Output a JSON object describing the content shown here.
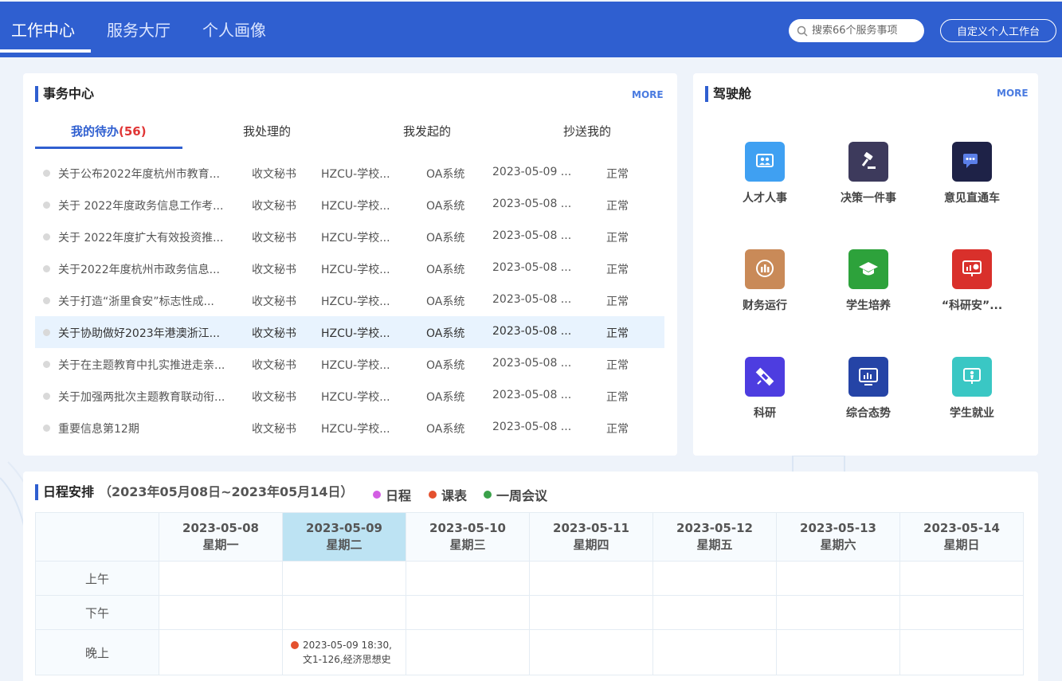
{
  "header": {
    "tabs": [
      "工作中心",
      "服务大厅",
      "个人画像"
    ],
    "search_placeholder": "搜索66个服务事项",
    "custom_button": "自定义个人工作台"
  },
  "affairs": {
    "title": "事务中心",
    "more": "MORE",
    "tabs": [
      {
        "label": "我的待办",
        "count": "(56)"
      },
      {
        "label": "我处理的"
      },
      {
        "label": "我发起的"
      },
      {
        "label": "抄送我的"
      }
    ],
    "rows": [
      {
        "title": "关于公布2022年度杭州市教育...",
        "type": "收文秘书",
        "dept": "HZCU-学校...",
        "system": "OA系统",
        "date": "2023-05-09 ...",
        "status": "正常"
      },
      {
        "title": "关于 2022年度政务信息工作考...",
        "type": "收文秘书",
        "dept": "HZCU-学校...",
        "system": "OA系统",
        "date": "2023-05-08 ...",
        "status": "正常"
      },
      {
        "title": "关于 2022年度扩大有效投资推...",
        "type": "收文秘书",
        "dept": "HZCU-学校...",
        "system": "OA系统",
        "date": "2023-05-08 ...",
        "status": "正常"
      },
      {
        "title": "关于2022年度杭州市政务信息...",
        "type": "收文秘书",
        "dept": "HZCU-学校...",
        "system": "OA系统",
        "date": "2023-05-08 ...",
        "status": "正常"
      },
      {
        "title": "关于打造“浙里食安”标志性成...",
        "type": "收文秘书",
        "dept": "HZCU-学校...",
        "system": "OA系统",
        "date": "2023-05-08 ...",
        "status": "正常"
      },
      {
        "title": "关于协助做好2023年港澳浙江...",
        "type": "收文秘书",
        "dept": "HZCU-学校...",
        "system": "OA系统",
        "date": "2023-05-08 ...",
        "status": "正常"
      },
      {
        "title": "关于在主题教育中扎实推进走亲...",
        "type": "收文秘书",
        "dept": "HZCU-学校...",
        "system": "OA系统",
        "date": "2023-05-08 ...",
        "status": "正常"
      },
      {
        "title": "关于加强两批次主题教育联动衔...",
        "type": "收文秘书",
        "dept": "HZCU-学校...",
        "system": "OA系统",
        "date": "2023-05-08 ...",
        "status": "正常"
      },
      {
        "title": "重要信息第12期",
        "type": "收文秘书",
        "dept": "HZCU-学校...",
        "system": "OA系统",
        "date": "2023-05-08 ...",
        "status": "正常"
      }
    ]
  },
  "cockpit": {
    "title": "驾驶舱",
    "more": "MORE",
    "tiles": [
      {
        "label": "人才人事",
        "icon": "people-board-icon",
        "color": "#3fa0f2"
      },
      {
        "label": "决策一件事",
        "icon": "gavel-icon",
        "color": "#3d3a5c"
      },
      {
        "label": "意见直通车",
        "icon": "chat-bubble-icon",
        "color": "#1e2247"
      },
      {
        "label": "财务运行",
        "icon": "finance-chart-icon",
        "color": "#c98a58"
      },
      {
        "label": "学生培养",
        "icon": "graduation-cap-icon",
        "color": "#2da23b"
      },
      {
        "label": "“科研安”...",
        "icon": "monitor-chart-icon",
        "color": "#d9302b"
      },
      {
        "label": "科研",
        "icon": "satellite-icon",
        "color": "#4d3de0"
      },
      {
        "label": "综合态势",
        "icon": "bar-chart-screen-icon",
        "color": "#2544a6"
      },
      {
        "label": "学生就业",
        "icon": "employment-icon",
        "color": "#3ac7c4"
      }
    ]
  },
  "schedule": {
    "title": "日程安排",
    "range": "（2023年05月08日~2023年05月14日）",
    "legend": [
      {
        "label": "日程",
        "color": "#d35ee3"
      },
      {
        "label": "课表",
        "color": "#e4512e"
      },
      {
        "label": "一周会议",
        "color": "#3aa14a"
      }
    ],
    "days": [
      {
        "date": "2023-05-08",
        "weekday": "星期一"
      },
      {
        "date": "2023-05-09",
        "weekday": "星期二"
      },
      {
        "date": "2023-05-10",
        "weekday": "星期三"
      },
      {
        "date": "2023-05-11",
        "weekday": "星期四"
      },
      {
        "date": "2023-05-12",
        "weekday": "星期五"
      },
      {
        "date": "2023-05-13",
        "weekday": "星期六"
      },
      {
        "date": "2023-05-14",
        "weekday": "星期日"
      }
    ],
    "periods": [
      "上午",
      "下午",
      "晚上"
    ],
    "events": [
      {
        "period": 2,
        "day": 1,
        "text": "2023-05-09 18:30,文1-126,经济思想史"
      }
    ]
  }
}
